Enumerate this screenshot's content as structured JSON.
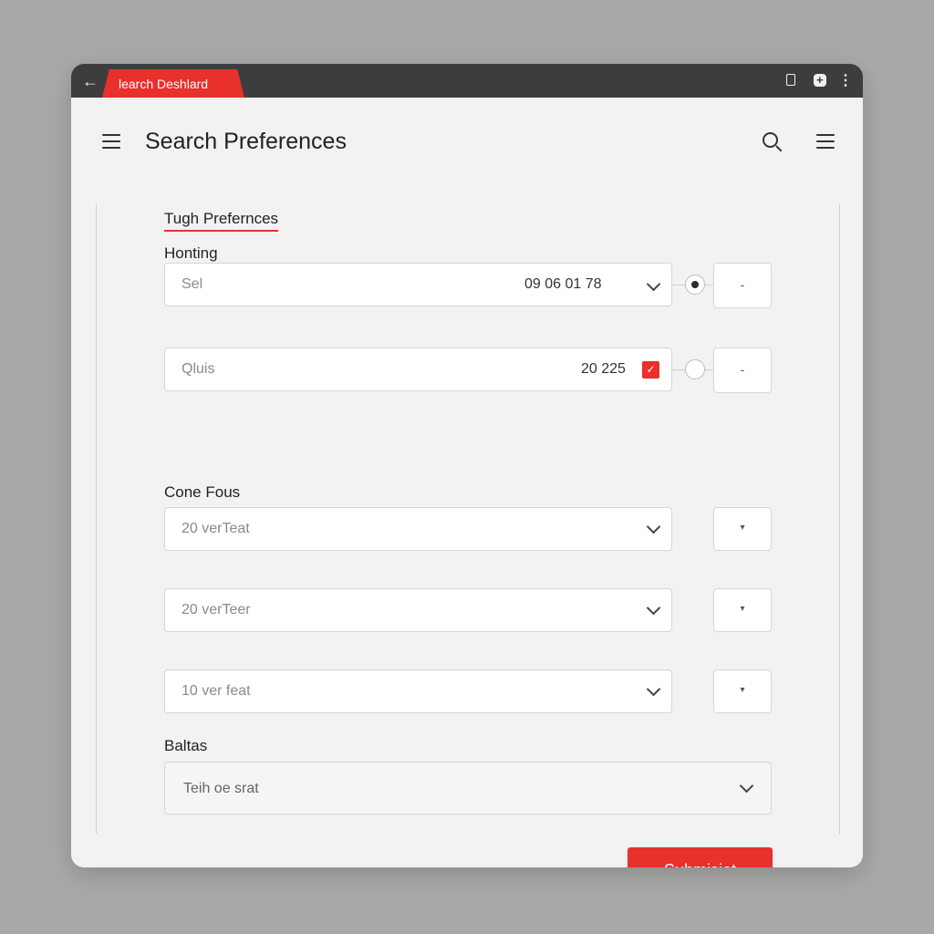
{
  "browser": {
    "tab_title": "learch Deshlard",
    "icons": [
      "back-arrow-icon",
      "clipboard-icon",
      "extension-icon",
      "more-vertical-icon"
    ]
  },
  "header": {
    "title": "Search Preferences",
    "icons": [
      "hamburger-menu-icon",
      "search-icon",
      "menu-icon"
    ]
  },
  "form": {
    "section_title": "Tugh Prefernces",
    "group1_label": "Honting",
    "row1": {
      "placeholder": "Sel",
      "value": "09  06  01  78",
      "stepper": "-"
    },
    "row2": {
      "placeholder": "Qluis",
      "value": "20 225",
      "checkbox_checked": true,
      "checkbox_mark": "✓",
      "stepper": "-"
    },
    "group2_label": "Cone Fous",
    "dropdowns": [
      {
        "placeholder": "20 verTeat",
        "stepper": "▾"
      },
      {
        "placeholder": "20 verTeer",
        "stepper": "▾"
      },
      {
        "placeholder": "10 ver feat",
        "stepper": "▾"
      }
    ],
    "group3_label": "Baltas",
    "wide_select": {
      "placeholder": "Teih oe srat"
    },
    "submit_label": "Submisiot"
  },
  "colors": {
    "accent": "#e8302d",
    "titlebar": "#3d3d40",
    "background": "#a9a9a9",
    "card": "#f2f2f2"
  }
}
